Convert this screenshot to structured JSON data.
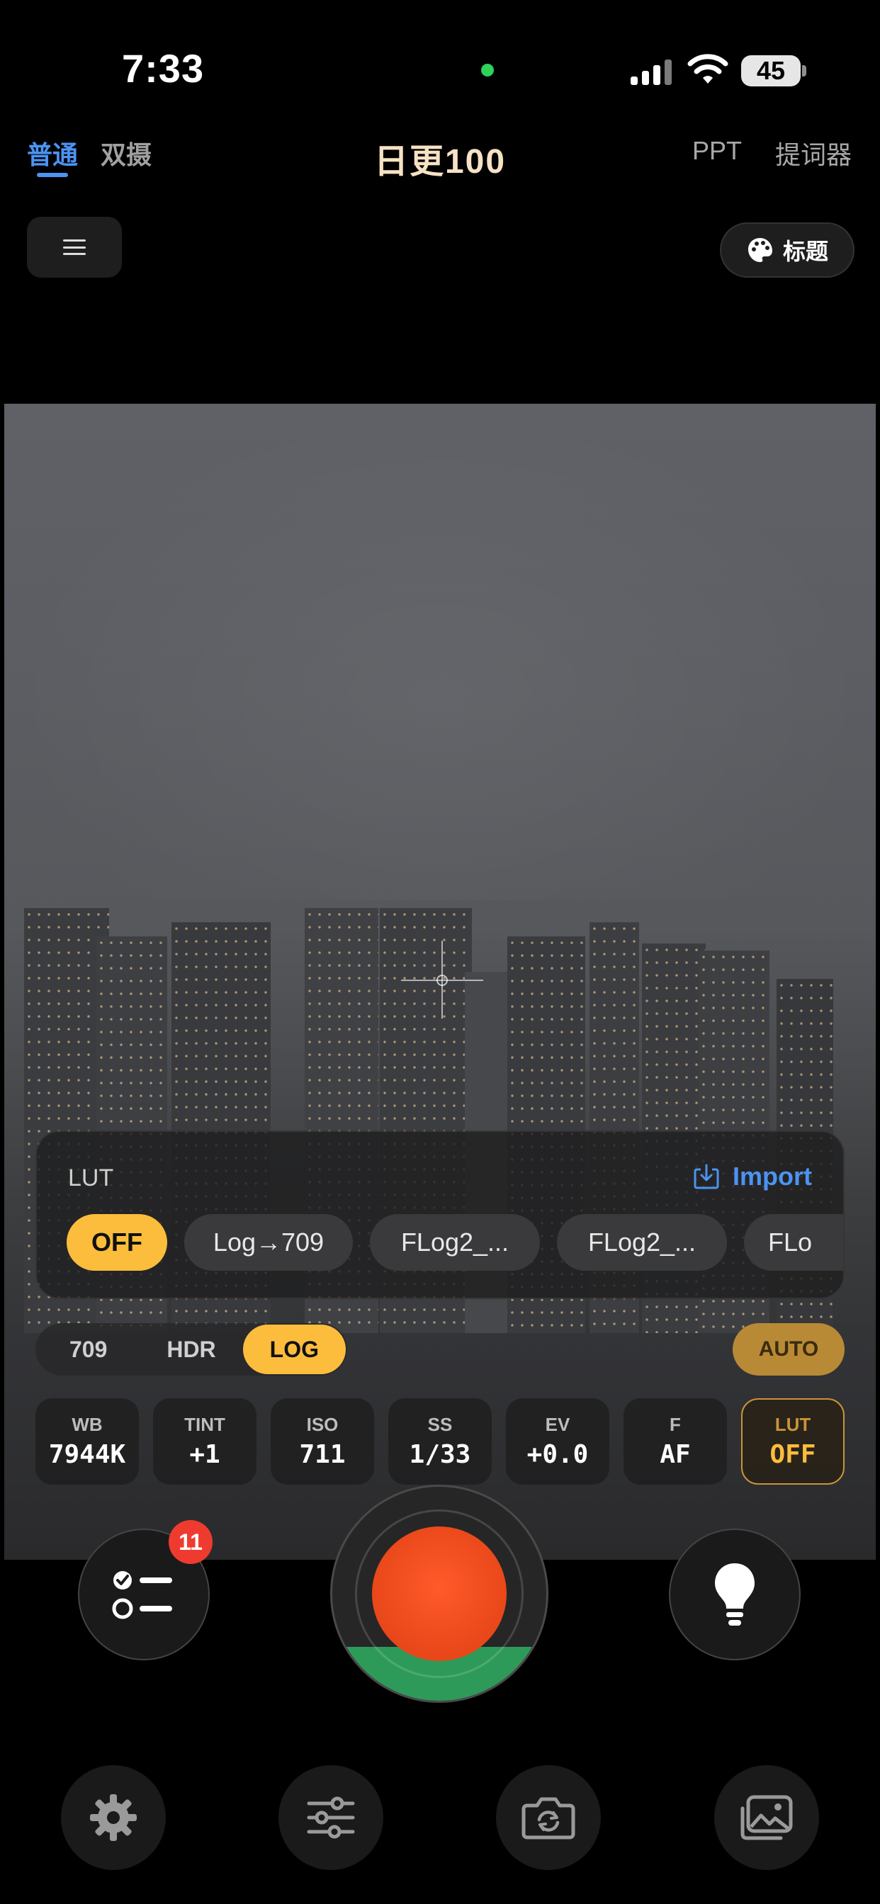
{
  "status_bar": {
    "time": "7:33",
    "battery": "45"
  },
  "top_nav": {
    "tab_normal": "普通",
    "tab_dual": "双摄",
    "app_title": "日更100",
    "ppt": "PPT",
    "teleprompter": "提词器"
  },
  "toolbar": {
    "title_button": "标题"
  },
  "lut_panel": {
    "label": "LUT",
    "import_label": "Import",
    "chips": [
      {
        "label": "OFF",
        "active": true
      },
      {
        "label": "Log→709",
        "active": false
      },
      {
        "label": "FLog2_...",
        "active": false
      },
      {
        "label": "FLog2_...",
        "active": false
      },
      {
        "label": "FLo",
        "active": false
      }
    ]
  },
  "color_modes": {
    "options": [
      "709",
      "HDR",
      "LOG"
    ],
    "selected": "LOG",
    "auto_label": "AUTO"
  },
  "params": [
    {
      "key": "WB",
      "value": "7944K"
    },
    {
      "key": "TINT",
      "value": "+1"
    },
    {
      "key": "ISO",
      "value": "711"
    },
    {
      "key": "SS",
      "value": "1/33"
    },
    {
      "key": "EV",
      "value": "+0.0"
    },
    {
      "key": "F",
      "value": "AF"
    },
    {
      "key": "LUT",
      "value": "OFF"
    }
  ],
  "tasks": {
    "badge_count": "11"
  },
  "colors": {
    "accent_blue": "#4c93f2",
    "accent_yellow": "#fcbd3c",
    "record_red": "#ef4a1f",
    "badge_red": "#ef3b2f",
    "record_green": "#2e9a5a"
  },
  "icons": {
    "menu": "hamburger-icon",
    "title": "palette-icon",
    "import": "download-icon",
    "tasks": "checklist-icon",
    "light": "bulb-icon",
    "settings": "gear-icon",
    "adjust": "sliders-icon",
    "flip": "camera-flip-icon",
    "gallery": "gallery-icon"
  }
}
